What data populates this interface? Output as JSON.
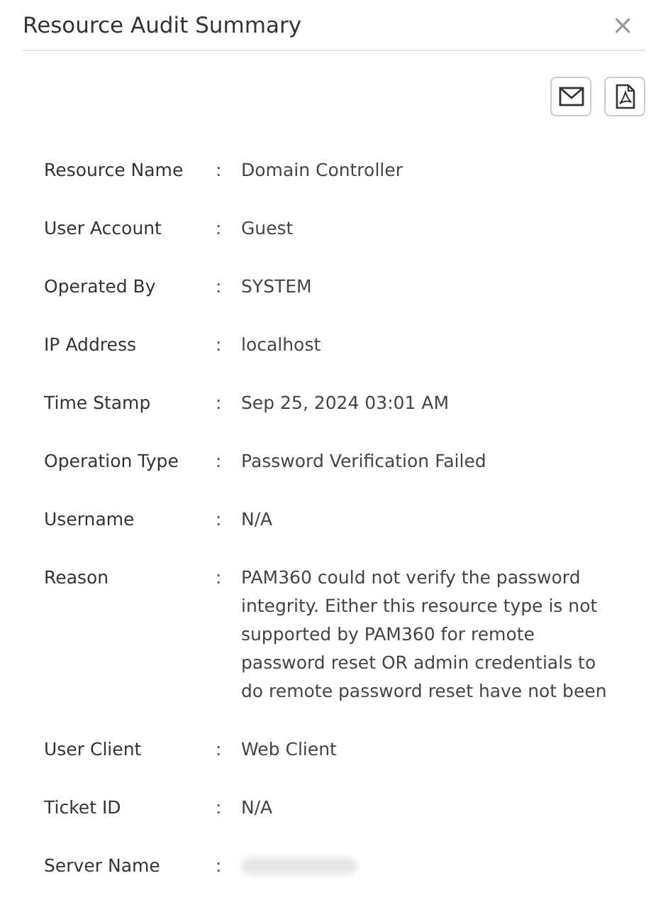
{
  "dialog": {
    "title": "Resource Audit Summary",
    "close": "×"
  },
  "toolbar": [
    {
      "kind": "email"
    },
    {
      "kind": "pdf"
    }
  ],
  "fields": [
    {
      "label": "Resource Name",
      "separator": ":",
      "kind": "text",
      "value": "Domain Controller"
    },
    {
      "label": "User Account",
      "separator": ":",
      "kind": "text",
      "value": "Guest"
    },
    {
      "label": "Operated By",
      "separator": ":",
      "kind": "text",
      "value": "SYSTEM"
    },
    {
      "label": "IP Address",
      "separator": ":",
      "kind": "text",
      "value": "localhost"
    },
    {
      "label": "Time Stamp",
      "separator": ":",
      "kind": "text",
      "value": "Sep 25, 2024 03:01 AM"
    },
    {
      "label": "Operation Type",
      "separator": ":",
      "kind": "text",
      "value": "Password Verification Failed"
    },
    {
      "label": "Username",
      "separator": ":",
      "kind": "text",
      "value": "N/A"
    },
    {
      "label": "Reason",
      "separator": ":",
      "kind": "text",
      "value": "PAM360 could not verify the password integrity. Either this resource type is not supported by PAM360 for remote password reset OR admin credentials to do remote password reset have not been"
    },
    {
      "label": "User Client",
      "separator": ":",
      "kind": "text",
      "value": "Web Client"
    },
    {
      "label": "Ticket ID",
      "separator": ":",
      "kind": "text",
      "value": "N/A"
    },
    {
      "label": "Server Name",
      "separator": ":",
      "kind": "redacted"
    }
  ]
}
